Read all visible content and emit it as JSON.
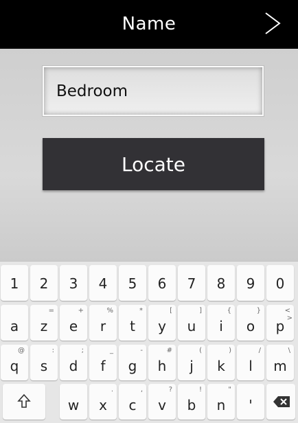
{
  "header": {
    "title": "Name",
    "next_icon": "chevron-right-icon"
  },
  "form": {
    "name_value": "Bedroom",
    "locate_label": "Locate"
  },
  "keyboard": {
    "row1": [
      "1",
      "2",
      "3",
      "4",
      "5",
      "6",
      "7",
      "8",
      "9",
      "0"
    ],
    "row2": [
      {
        "key": "a",
        "sub": ""
      },
      {
        "key": "z",
        "sub": "="
      },
      {
        "key": "e",
        "sub": "+"
      },
      {
        "key": "r",
        "sub": "%"
      },
      {
        "key": "t",
        "sub": "*"
      },
      {
        "key": "y",
        "sub": "["
      },
      {
        "key": "u",
        "sub": "]"
      },
      {
        "key": "i",
        "sub": "{"
      },
      {
        "key": "o",
        "sub": "}"
      },
      {
        "key": "p",
        "sub": "<"
      }
    ],
    "row2_extra_sub": ">",
    "row3": [
      {
        "key": "q",
        "sub": "@"
      },
      {
        "key": "s",
        "sub": ":"
      },
      {
        "key": "d",
        "sub": ";"
      },
      {
        "key": "f",
        "sub": "_"
      },
      {
        "key": "g",
        "sub": "-"
      },
      {
        "key": "h",
        "sub": "#"
      },
      {
        "key": "j",
        "sub": "("
      },
      {
        "key": "k",
        "sub": ")"
      },
      {
        "key": "l",
        "sub": "/"
      },
      {
        "key": "m",
        "sub": "\\"
      }
    ],
    "row4": [
      {
        "key": "w",
        "sub": ""
      },
      {
        "key": "x",
        "sub": "."
      },
      {
        "key": "c",
        "sub": ","
      },
      {
        "key": "v",
        "sub": "?"
      },
      {
        "key": "b",
        "sub": "!"
      },
      {
        "key": "n",
        "sub": "\""
      },
      {
        "key": "'",
        "sub": ""
      }
    ],
    "shift_icon": "shift-arrow-icon",
    "backspace_icon": "backspace-icon"
  }
}
